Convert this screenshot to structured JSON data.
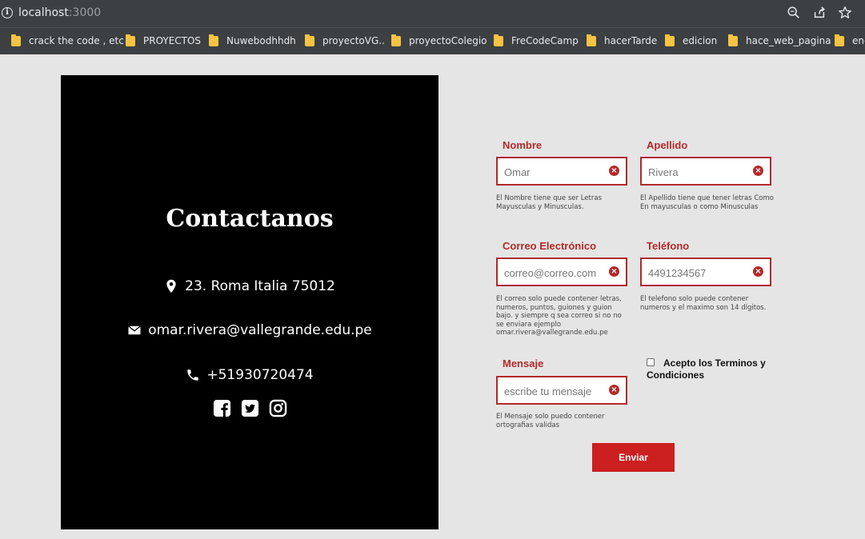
{
  "browser": {
    "url_host": "localhost",
    "url_port": ":3000",
    "bookmarks": [
      "crack the code , etc",
      "PROYECTOS",
      "Nuwebodhhdh",
      "proyectoVG..",
      "proyectoColegio",
      "FreCodeCamp",
      "hacerTarde",
      "edicion",
      "hace_web_pagina",
      "enc"
    ]
  },
  "contact": {
    "title": "Contactanos",
    "address": "23. Roma Italia 75012",
    "email": "omar.rivera@vallegrande.edu.pe",
    "phone": "+51930720474",
    "social_icons": [
      "facebook-icon",
      "twitter-icon",
      "instagram-icon"
    ]
  },
  "form": {
    "nombre": {
      "label": "Nombre",
      "placeholder": "Omar",
      "help": "El Nombre tiene que ser Letras Mayusculas y Minusculas."
    },
    "apellido": {
      "label": "Apellido",
      "placeholder": "Rivera",
      "help": "El Apellido tiene que tener letras Como En mayusculas o como Minusculas"
    },
    "correo": {
      "label": "Correo Electrónico",
      "placeholder": "correo@correo.com",
      "help": "El correo solo puede contener letras, numeros, puntos, guiones y guion bajo. y siempre q sea correo si no no se enviara ejemplo omar.rivera@vallegrande.edu.pe"
    },
    "telefono": {
      "label": "Teléfono",
      "placeholder": "4491234567",
      "help": "El telefono solo puede contener numeros y el maximo son 14 dígitos."
    },
    "mensaje": {
      "label": "Mensaje",
      "placeholder": "escribe tu mensaje",
      "help": "El Mensaje solo puedo contener ortografias validas"
    },
    "terms_label": "Acepto los Terminos y Condiciones",
    "submit_label": "Enviar",
    "error_icon": "x-circle-icon"
  },
  "colors": {
    "accent": "#b22a2a",
    "button": "#cc1f1f",
    "panel": "#000000",
    "background": "#e5e5e5"
  }
}
